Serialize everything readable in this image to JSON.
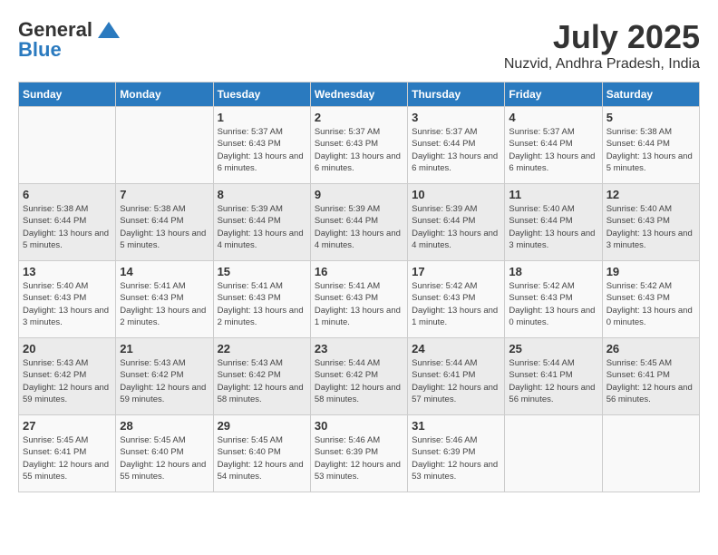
{
  "header": {
    "logo_general": "General",
    "logo_blue": "Blue",
    "month_title": "July 2025",
    "location": "Nuzvid, Andhra Pradesh, India"
  },
  "days_of_week": [
    "Sunday",
    "Monday",
    "Tuesday",
    "Wednesday",
    "Thursday",
    "Friday",
    "Saturday"
  ],
  "weeks": [
    [
      {
        "day": "",
        "info": ""
      },
      {
        "day": "",
        "info": ""
      },
      {
        "day": "1",
        "info": "Sunrise: 5:37 AM\nSunset: 6:43 PM\nDaylight: 13 hours and 6 minutes."
      },
      {
        "day": "2",
        "info": "Sunrise: 5:37 AM\nSunset: 6:43 PM\nDaylight: 13 hours and 6 minutes."
      },
      {
        "day": "3",
        "info": "Sunrise: 5:37 AM\nSunset: 6:44 PM\nDaylight: 13 hours and 6 minutes."
      },
      {
        "day": "4",
        "info": "Sunrise: 5:37 AM\nSunset: 6:44 PM\nDaylight: 13 hours and 6 minutes."
      },
      {
        "day": "5",
        "info": "Sunrise: 5:38 AM\nSunset: 6:44 PM\nDaylight: 13 hours and 5 minutes."
      }
    ],
    [
      {
        "day": "6",
        "info": "Sunrise: 5:38 AM\nSunset: 6:44 PM\nDaylight: 13 hours and 5 minutes."
      },
      {
        "day": "7",
        "info": "Sunrise: 5:38 AM\nSunset: 6:44 PM\nDaylight: 13 hours and 5 minutes."
      },
      {
        "day": "8",
        "info": "Sunrise: 5:39 AM\nSunset: 6:44 PM\nDaylight: 13 hours and 4 minutes."
      },
      {
        "day": "9",
        "info": "Sunrise: 5:39 AM\nSunset: 6:44 PM\nDaylight: 13 hours and 4 minutes."
      },
      {
        "day": "10",
        "info": "Sunrise: 5:39 AM\nSunset: 6:44 PM\nDaylight: 13 hours and 4 minutes."
      },
      {
        "day": "11",
        "info": "Sunrise: 5:40 AM\nSunset: 6:44 PM\nDaylight: 13 hours and 3 minutes."
      },
      {
        "day": "12",
        "info": "Sunrise: 5:40 AM\nSunset: 6:43 PM\nDaylight: 13 hours and 3 minutes."
      }
    ],
    [
      {
        "day": "13",
        "info": "Sunrise: 5:40 AM\nSunset: 6:43 PM\nDaylight: 13 hours and 3 minutes."
      },
      {
        "day": "14",
        "info": "Sunrise: 5:41 AM\nSunset: 6:43 PM\nDaylight: 13 hours and 2 minutes."
      },
      {
        "day": "15",
        "info": "Sunrise: 5:41 AM\nSunset: 6:43 PM\nDaylight: 13 hours and 2 minutes."
      },
      {
        "day": "16",
        "info": "Sunrise: 5:41 AM\nSunset: 6:43 PM\nDaylight: 13 hours and 1 minute."
      },
      {
        "day": "17",
        "info": "Sunrise: 5:42 AM\nSunset: 6:43 PM\nDaylight: 13 hours and 1 minute."
      },
      {
        "day": "18",
        "info": "Sunrise: 5:42 AM\nSunset: 6:43 PM\nDaylight: 13 hours and 0 minutes."
      },
      {
        "day": "19",
        "info": "Sunrise: 5:42 AM\nSunset: 6:43 PM\nDaylight: 13 hours and 0 minutes."
      }
    ],
    [
      {
        "day": "20",
        "info": "Sunrise: 5:43 AM\nSunset: 6:42 PM\nDaylight: 12 hours and 59 minutes."
      },
      {
        "day": "21",
        "info": "Sunrise: 5:43 AM\nSunset: 6:42 PM\nDaylight: 12 hours and 59 minutes."
      },
      {
        "day": "22",
        "info": "Sunrise: 5:43 AM\nSunset: 6:42 PM\nDaylight: 12 hours and 58 minutes."
      },
      {
        "day": "23",
        "info": "Sunrise: 5:44 AM\nSunset: 6:42 PM\nDaylight: 12 hours and 58 minutes."
      },
      {
        "day": "24",
        "info": "Sunrise: 5:44 AM\nSunset: 6:41 PM\nDaylight: 12 hours and 57 minutes."
      },
      {
        "day": "25",
        "info": "Sunrise: 5:44 AM\nSunset: 6:41 PM\nDaylight: 12 hours and 56 minutes."
      },
      {
        "day": "26",
        "info": "Sunrise: 5:45 AM\nSunset: 6:41 PM\nDaylight: 12 hours and 56 minutes."
      }
    ],
    [
      {
        "day": "27",
        "info": "Sunrise: 5:45 AM\nSunset: 6:41 PM\nDaylight: 12 hours and 55 minutes."
      },
      {
        "day": "28",
        "info": "Sunrise: 5:45 AM\nSunset: 6:40 PM\nDaylight: 12 hours and 55 minutes."
      },
      {
        "day": "29",
        "info": "Sunrise: 5:45 AM\nSunset: 6:40 PM\nDaylight: 12 hours and 54 minutes."
      },
      {
        "day": "30",
        "info": "Sunrise: 5:46 AM\nSunset: 6:39 PM\nDaylight: 12 hours and 53 minutes."
      },
      {
        "day": "31",
        "info": "Sunrise: 5:46 AM\nSunset: 6:39 PM\nDaylight: 12 hours and 53 minutes."
      },
      {
        "day": "",
        "info": ""
      },
      {
        "day": "",
        "info": ""
      }
    ]
  ]
}
